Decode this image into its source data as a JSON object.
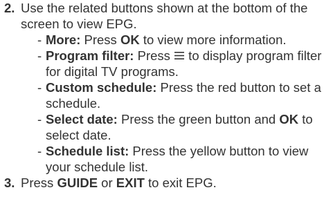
{
  "steps": [
    {
      "number": "2.",
      "text": "Use the related buttons shown at the bottom of the screen to view EPG.",
      "items": [
        {
          "label": "More:",
          "p1": " Press ",
          "b1": "OK",
          "p2": " to view more information."
        },
        {
          "label": "Program filter:",
          "p1": " Press ",
          "icon": "menu-icon",
          "p2": " to display program filter for digital TV programs."
        },
        {
          "label": "Custom schedule:",
          "p1": " Press the red button to set a schedule."
        },
        {
          "label": "Select date:",
          "p1": " Press the green button and ",
          "b1": "OK",
          "p2": " to select date."
        },
        {
          "label": "Schedule list:",
          "p1": " Press the yellow button to view your schedule list."
        }
      ]
    },
    {
      "number": "3.",
      "p1": "Press ",
      "b1": "GUIDE",
      "p2": " or ",
      "b2": "EXIT",
      "p3": " to exit EPG."
    }
  ]
}
